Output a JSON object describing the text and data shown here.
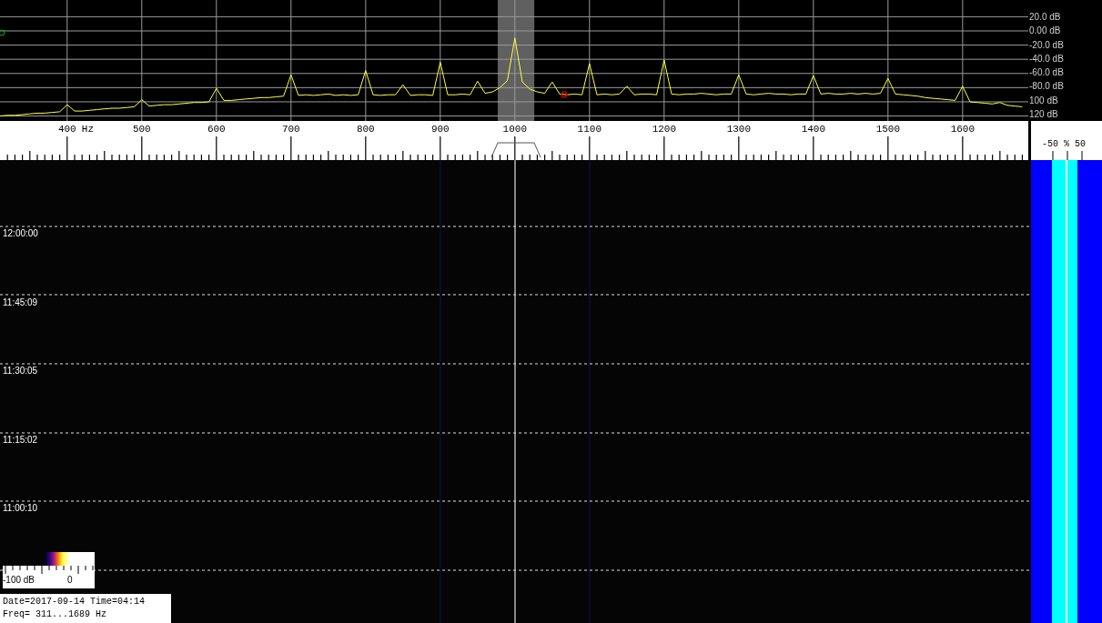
{
  "spectrum": {
    "chart_data": {
      "type": "line",
      "xlabel": "Hz",
      "grid": true,
      "bands": [
        {
          "axis": "x",
          "from": 977,
          "to": 1026
        }
      ],
      "xlim": [
        310,
        1688
      ],
      "ylim": [
        -127,
        43.6
      ],
      "xticks": [
        {
          "value": 400,
          "label": "400"
        },
        {
          "value": 500,
          "label": "500"
        },
        {
          "value": 600,
          "label": "600"
        },
        {
          "value": 700,
          "label": "700"
        },
        {
          "value": 800,
          "label": "800"
        },
        {
          "value": 900,
          "label": "900"
        },
        {
          "value": 1000,
          "label": "1000"
        },
        {
          "value": 1100,
          "label": "1100"
        },
        {
          "value": 1200,
          "label": "1200"
        },
        {
          "value": 1300,
          "label": "1300"
        },
        {
          "value": 1400,
          "label": "1400"
        },
        {
          "value": 1500,
          "label": "1500"
        },
        {
          "value": 1600,
          "label": "1600"
        }
      ],
      "yticks": [
        {
          "value": 20,
          "label": "20.0 dB"
        },
        {
          "value": 0,
          "label": "0.00 dB"
        },
        {
          "value": -20,
          "label": "-20.0 dB"
        },
        {
          "value": -40,
          "label": "-40.0 dB"
        },
        {
          "value": -60,
          "label": "-60.0 dB"
        },
        {
          "value": -80,
          "label": "-80.0 dB"
        },
        {
          "value": -100,
          "label": "100 dB"
        },
        {
          "value": -120,
          "label": "120 dB"
        }
      ],
      "x": [
        310,
        320,
        330,
        340,
        350,
        360,
        370,
        380,
        390,
        400,
        410,
        420,
        430,
        440,
        450,
        460,
        470,
        480,
        490,
        500,
        510,
        520,
        530,
        540,
        550,
        560,
        570,
        580,
        590,
        600,
        610,
        620,
        630,
        640,
        650,
        660,
        670,
        680,
        690,
        700,
        710,
        720,
        730,
        740,
        750,
        760,
        770,
        780,
        790,
        800,
        810,
        820,
        830,
        840,
        850,
        860,
        870,
        880,
        890,
        900,
        910,
        920,
        930,
        940,
        950,
        960,
        970,
        980,
        990,
        1000,
        1010,
        1020,
        1030,
        1040,
        1050,
        1060,
        1070,
        1080,
        1090,
        1100,
        1110,
        1120,
        1130,
        1140,
        1150,
        1160,
        1170,
        1180,
        1190,
        1200,
        1210,
        1220,
        1230,
        1240,
        1250,
        1260,
        1270,
        1280,
        1290,
        1300,
        1310,
        1320,
        1330,
        1340,
        1350,
        1360,
        1370,
        1380,
        1390,
        1400,
        1410,
        1420,
        1430,
        1440,
        1450,
        1460,
        1470,
        1480,
        1490,
        1500,
        1510,
        1520,
        1530,
        1540,
        1550,
        1560,
        1570,
        1580,
        1590,
        1600,
        1610,
        1620,
        1630,
        1640,
        1650,
        1660,
        1670,
        1680
      ],
      "series": [
        {
          "color": "#ffff40",
          "values": [
            -120,
            -119,
            -119,
            -118,
            -117,
            -116,
            -116,
            -115,
            -114,
            -104,
            -113,
            -113,
            -112,
            -111,
            -110,
            -109,
            -109,
            -108,
            -107,
            -97,
            -106,
            -105,
            -104,
            -104,
            -103,
            -102,
            -101,
            -101,
            -100,
            -81,
            -98,
            -98,
            -97,
            -96,
            -95,
            -94,
            -94,
            -93,
            -92,
            -62,
            -91,
            -90,
            -91,
            -90,
            -89,
            -91,
            -90,
            -91,
            -90,
            -56,
            -90,
            -91,
            -90,
            -90,
            -76,
            -91,
            -90,
            -90,
            -91,
            -44,
            -90,
            -90,
            -89,
            -90,
            -71,
            -88,
            -86,
            -80,
            -70,
            -10,
            -72,
            -82,
            -86,
            -88,
            -72,
            -89,
            -90,
            -89,
            -90,
            -46,
            -90,
            -89,
            -90,
            -89,
            -78,
            -90,
            -89,
            -89,
            -90,
            -41,
            -89,
            -90,
            -89,
            -89,
            -88,
            -89,
            -90,
            -89,
            -89,
            -62,
            -89,
            -90,
            -89,
            -88,
            -89,
            -89,
            -90,
            -89,
            -89,
            -63,
            -89,
            -88,
            -89,
            -89,
            -88,
            -89,
            -88,
            -89,
            -88,
            -67,
            -89,
            -90,
            -91,
            -92,
            -94,
            -95,
            -96,
            -97,
            -98,
            -78,
            -100,
            -101,
            -102,
            -103,
            -101,
            -105,
            -106,
            -107
          ]
        }
      ]
    }
  },
  "tuning_scale": {
    "labels": [
      "-50",
      "%",
      "50"
    ]
  },
  "waterfall": {
    "time_labels": [
      "12:00:00",
      "11:45:09",
      "11:30:05",
      "11:15:02",
      "11:00:10"
    ]
  },
  "color_legend": {
    "min_label": "-100 dB",
    "max_label": "0"
  },
  "info_box": {
    "date_line": "Date=2017-09-14 Time=04:14",
    "freq_line": "Freq= 311...1689 Hz"
  }
}
